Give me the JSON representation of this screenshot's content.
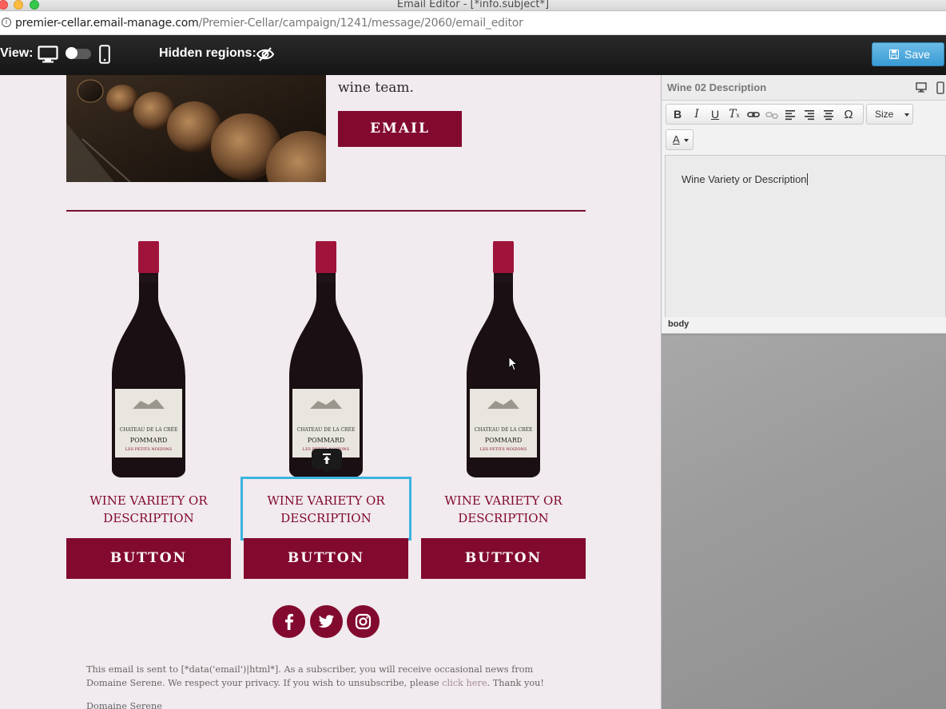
{
  "window": {
    "title": "Email Editor - [*info.subject*]"
  },
  "url": {
    "host": "premier-cellar.email-manage.com",
    "path": "/Premier-Cellar/campaign/1241/message/2060/email_editor"
  },
  "toolbar": {
    "view_label": "View:",
    "hidden_regions_label": "Hidden regions:",
    "save_label": "Save"
  },
  "email": {
    "hero_text": "wine team.",
    "email_button": "EMAIL",
    "products": [
      {
        "description_line1": "Wine Variety or",
        "description_line2": "Description",
        "button": "BUTTON",
        "label_name": "CHATEAU DE LA CRÉE",
        "label_wine": "POMMARD",
        "label_sub": "LES PETITS NOIZONS"
      },
      {
        "description_line1": "Wine Variety or",
        "description_line2": "Description",
        "button": "BUTTON",
        "label_name": "CHATEAU DE LA CRÉE",
        "label_wine": "POMMARD",
        "label_sub": "LES PETITS NOIZONS"
      },
      {
        "description_line1": "Wine Variety or",
        "description_line2": "Description",
        "button": "BUTTON",
        "label_name": "CHATEAU DE LA CRÉE",
        "label_wine": "POMMARD",
        "label_sub": "LES PETITS NOIZONS"
      }
    ],
    "social": [
      "facebook-icon",
      "twitter-icon",
      "instagram-icon"
    ],
    "footer": {
      "text_before": "This email is sent to [*data('email')|html*]. As a subscriber, you will receive occasional news from Domaine Serene. We respect your privacy. If you wish to unsubscribe, please ",
      "link": "click here",
      "text_after": ". Thank you!",
      "company": "Domaine Serene"
    }
  },
  "panel": {
    "title": "Wine 02 Description",
    "size_label": "Size",
    "color_label": "A",
    "editor_content": "Wine Variety or Description",
    "path": "body"
  },
  "colors": {
    "brand": "#820a2f",
    "selection": "#3bb4e0",
    "save": "#3a9bd4"
  }
}
